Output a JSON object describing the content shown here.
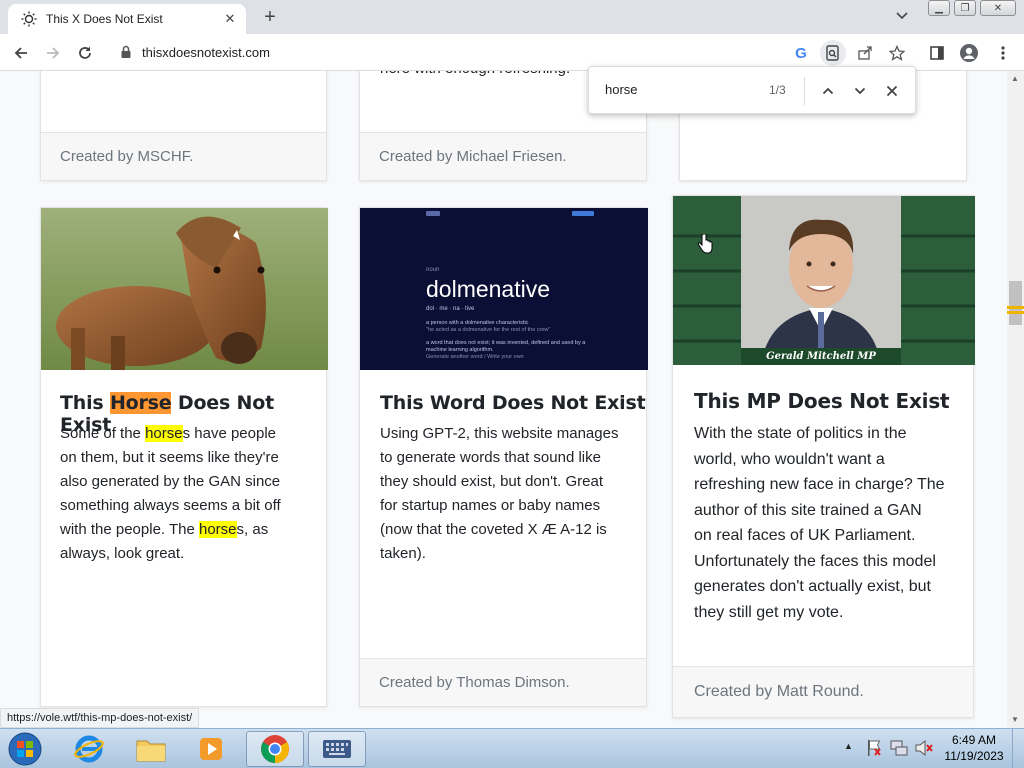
{
  "browser": {
    "tab_title": "This X Does Not Exist",
    "url": "thisxdoesnotexist.com",
    "status_url": "https://vole.wtf/this-mp-does-not-exist/"
  },
  "find": {
    "query": "horse",
    "count": "1/3"
  },
  "top_cards": [
    {
      "footer": "Created by MSCHF."
    },
    {
      "text": "here with enough refreshing.",
      "footer": "Created by Michael Friesen."
    },
    {
      "footer": ""
    }
  ],
  "cards": [
    {
      "title_pre": "This ",
      "title_hl": "Horse",
      "title_post": " Does Not Exist",
      "text": [
        [
          "Some of the ",
          "horse",
          "s have people"
        ],
        [
          "on them, but it seems like they're"
        ],
        [
          "also generated by the GAN since"
        ],
        [
          "something always seems a bit off"
        ],
        [
          "with the people. The ",
          "horse",
          "s, as"
        ],
        [
          "always, look great."
        ]
      ],
      "footer": ""
    },
    {
      "title": "This Word Does Not Exist",
      "image": {
        "word": "dolmenative",
        "noun": "noun",
        "pron": "dol · me · na · tive",
        "def1": "a person with a dolmenative characteristic",
        "ex1": "\"he acted as a dolmenative for the rest of the crew\"",
        "def2": "a word that does not exist; it was invented, defined and used by a machine learning algorithm.",
        "links": "Generate another word / Write your own"
      },
      "text": [
        "Using GPT-2, this website manages",
        "to generate words that sound like",
        "they should exist, but don't. Great",
        "for startup names or baby names",
        "(now that the coveted X Æ A-12 is",
        "taken)."
      ],
      "footer": "Created by Thomas Dimson."
    },
    {
      "title": "This MP Does Not Exist",
      "caption": "Gerald Mitchell MP",
      "text": [
        "With the state of politics in the",
        "world, who wouldn't want a",
        "refreshing new face in charge? The",
        "author of this site trained a GAN",
        "on real faces of UK Parliament.",
        "Unfortunately the faces this model",
        "generates don't actually exist, but",
        "they still get my vote."
      ],
      "footer": "Created by Matt Round."
    }
  ],
  "taskbar": {
    "time": "6:49 AM",
    "date": "11/19/2023"
  }
}
